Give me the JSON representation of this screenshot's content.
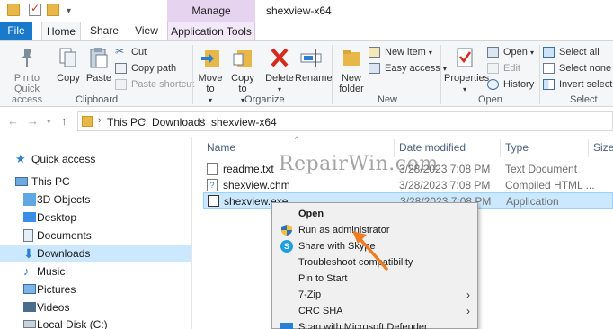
{
  "window": {
    "title": "shexview-x64",
    "context_tab_group": "Manage"
  },
  "tabs": {
    "file": "File",
    "home": "Home",
    "share": "Share",
    "view": "View",
    "app_tools": "Application Tools"
  },
  "ribbon": {
    "clipboard": {
      "label": "Clipboard",
      "pin": "Pin to Quick access",
      "copy": "Copy",
      "paste": "Paste",
      "cut": "Cut",
      "copy_path": "Copy path",
      "paste_shortcut": "Paste shortcut"
    },
    "organize": {
      "label": "Organize",
      "move_to": "Move to",
      "copy_to": "Copy to",
      "delete": "Delete",
      "rename": "Rename"
    },
    "new": {
      "label": "New",
      "new_folder": "New folder",
      "new_item": "New item",
      "easy_access": "Easy access"
    },
    "open": {
      "label": "Open",
      "properties": "Properties",
      "open": "Open",
      "edit": "Edit",
      "history": "History"
    },
    "select": {
      "label": "Select",
      "select_all": "Select all",
      "select_none": "Select none",
      "invert": "Invert selection"
    }
  },
  "address": {
    "crumbs": [
      "This PC",
      "Downloads",
      "shexview-x64"
    ]
  },
  "nav_pane": {
    "items": [
      "Quick access",
      "This PC",
      "3D Objects",
      "Desktop",
      "Documents",
      "Downloads",
      "Music",
      "Pictures",
      "Videos",
      "Local Disk (C:)"
    ]
  },
  "columns": {
    "name": "Name",
    "date": "Date modified",
    "type": "Type",
    "size": "Size"
  },
  "files": [
    {
      "name": "readme.txt",
      "date": "3/28/2023 7:08 PM",
      "type": "Text Document"
    },
    {
      "name": "shexview.chm",
      "date": "3/28/2023 7:08 PM",
      "type": "Compiled HTML ..."
    },
    {
      "name": "shexview.exe",
      "date": "3/28/2023 7:08 PM",
      "type": "Application"
    }
  ],
  "context_menu": {
    "items": [
      "Open",
      "Run as administrator",
      "Share with Skype",
      "Troubleshoot compatibility",
      "Pin to Start",
      "7-Zip",
      "CRC SHA",
      "Scan with Microsoft Defender"
    ]
  },
  "watermark": "RepairWin.com",
  "colors": {
    "accent": "#1979ca",
    "selection": "#cce8ff",
    "manage_tab": "#e6d3f0",
    "annotation_arrow": "#f07c22"
  }
}
